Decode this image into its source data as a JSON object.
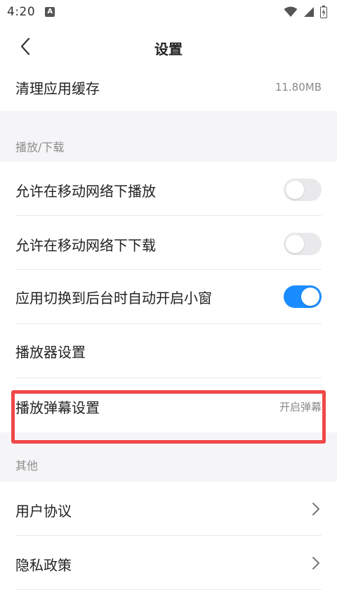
{
  "status_bar": {
    "time": "4:20",
    "notification_icon": "A"
  },
  "header": {
    "title": "设置"
  },
  "cache": {
    "label": "清理应用缓存",
    "value": "11.80MB"
  },
  "sections": {
    "playback": "播放/下载",
    "other": "其他"
  },
  "playback_items": {
    "mobile_play": {
      "label": "允许在移动网络下播放",
      "on": false
    },
    "mobile_download": {
      "label": "允许在移动网络下下载",
      "on": false
    },
    "auto_pip": {
      "label": "应用切换到后台时自动开启小窗",
      "on": true
    },
    "player_settings": {
      "label": "播放器设置"
    },
    "danmaku": {
      "label": "播放弹幕设置",
      "value": "开启弹幕"
    }
  },
  "other_items": {
    "user_agreement": "用户协议",
    "privacy_policy": "隐私政策"
  },
  "colors": {
    "accent": "#1a8cff",
    "highlight": "#f04848",
    "section_bg": "#f5f5f7"
  }
}
